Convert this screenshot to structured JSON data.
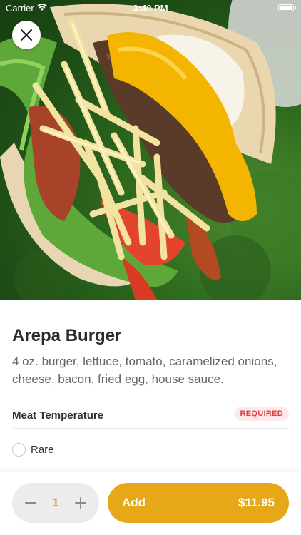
{
  "status_bar": {
    "carrier": "Carrier",
    "time": "3:40 PM"
  },
  "hero": {
    "image": "arepa-burger-photo"
  },
  "item": {
    "name": "Arepa Burger",
    "description": "4 oz. burger, lettuce, tomato, caramelized onions, cheese, bacon, fried egg, house sauce."
  },
  "modifier_group": {
    "title": "Meat Temperature",
    "badge": "REQUIRED",
    "options": [
      {
        "label": "Rare",
        "selected": false
      }
    ]
  },
  "order": {
    "quantity": "1",
    "add_label": "Add",
    "price": "$11.95"
  },
  "colors": {
    "accent": "#e6a817",
    "required_badge_bg": "#fde9ea",
    "required_badge_text": "#d9423f"
  }
}
